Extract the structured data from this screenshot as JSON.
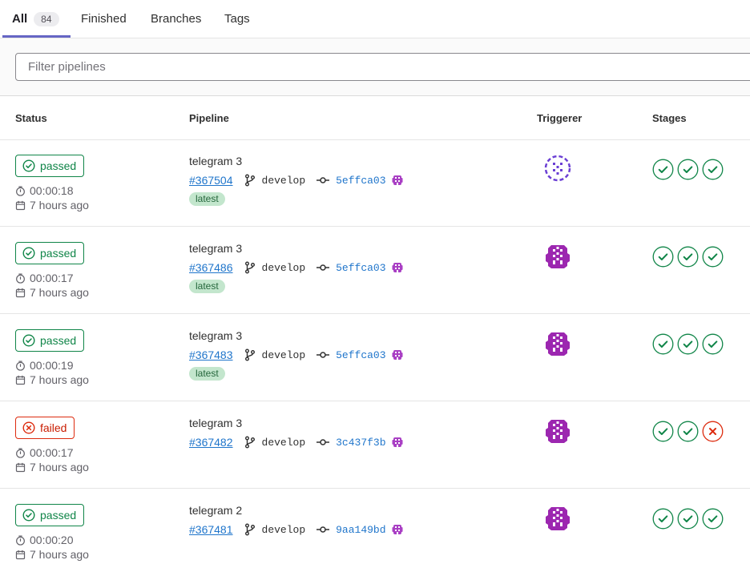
{
  "tabs": {
    "all_label": "All",
    "all_count": "84",
    "finished_label": "Finished",
    "branches_label": "Branches",
    "tags_label": "Tags"
  },
  "filter": {
    "placeholder": "Filter pipelines"
  },
  "columns": {
    "status": "Status",
    "pipeline": "Pipeline",
    "triggerer": "Triggerer",
    "stages": "Stages"
  },
  "colors": {
    "success": "#108548",
    "failed": "#dd2b0e",
    "link": "#1f75cb",
    "active_tab": "#6666c4",
    "avatar_purple": "#9c27b0"
  },
  "rows": [
    {
      "status": "passed",
      "duration": "00:00:18",
      "finished": "7 hours ago",
      "name": "telegram 3",
      "id": "#367504",
      "branch": "develop",
      "sha": "5effca03",
      "latest": "latest",
      "triggerer_avatar": "identicon-light",
      "stages": [
        "success",
        "success",
        "success"
      ]
    },
    {
      "status": "passed",
      "duration": "00:00:17",
      "finished": "7 hours ago",
      "name": "telegram 3",
      "id": "#367486",
      "branch": "develop",
      "sha": "5effca03",
      "latest": "latest",
      "triggerer_avatar": "identicon-solid",
      "stages": [
        "success",
        "success",
        "success"
      ]
    },
    {
      "status": "passed",
      "duration": "00:00:19",
      "finished": "7 hours ago",
      "name": "telegram 3",
      "id": "#367483",
      "branch": "develop",
      "sha": "5effca03",
      "latest": "latest",
      "triggerer_avatar": "identicon-solid",
      "stages": [
        "success",
        "success",
        "success"
      ]
    },
    {
      "status": "failed",
      "duration": "00:00:17",
      "finished": "7 hours ago",
      "name": "telegram 3",
      "id": "#367482",
      "branch": "develop",
      "sha": "3c437f3b",
      "latest": null,
      "triggerer_avatar": "identicon-solid",
      "stages": [
        "success",
        "success",
        "failed"
      ]
    },
    {
      "status": "passed",
      "duration": "00:00:20",
      "finished": "7 hours ago",
      "name": "telegram 2",
      "id": "#367481",
      "branch": "develop",
      "sha": "9aa149bd",
      "latest": null,
      "triggerer_avatar": "identicon-solid",
      "stages": [
        "success",
        "success",
        "success"
      ]
    }
  ]
}
